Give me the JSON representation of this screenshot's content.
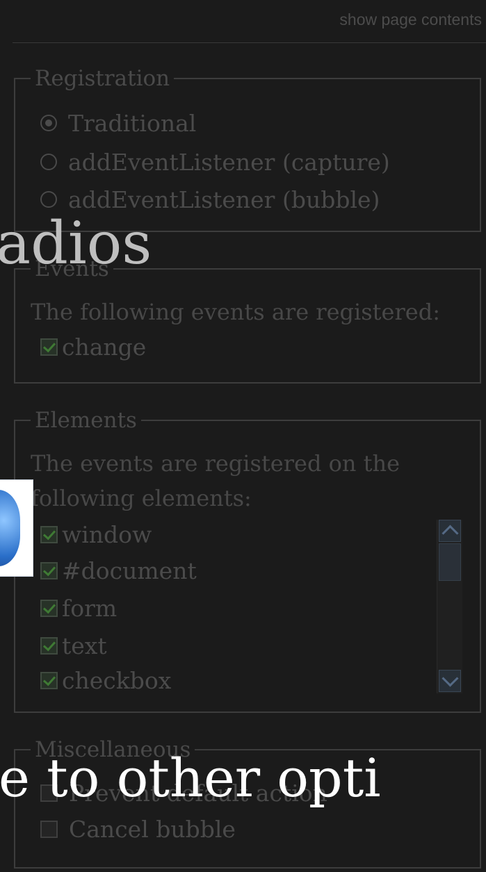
{
  "header": {
    "show_contents": "show page contents"
  },
  "registration": {
    "legend": "Registration",
    "options": [
      {
        "label": "Traditional",
        "selected": true
      },
      {
        "label": "addEventListener (capture)",
        "selected": false
      },
      {
        "label": "addEventListener (bubble)",
        "selected": false
      }
    ]
  },
  "events": {
    "legend": "Events",
    "intro": "The following events are registered:",
    "items": [
      {
        "label": "change",
        "checked": true
      }
    ]
  },
  "elements": {
    "legend": "Elements",
    "intro_line1": "The events are registered on the",
    "intro_line2": "following elements:",
    "items": [
      {
        "label": "window",
        "checked": true
      },
      {
        "label": "#document",
        "checked": true
      },
      {
        "label": "form",
        "checked": true
      },
      {
        "label": "text",
        "checked": true
      },
      {
        "label": "checkbox",
        "checked": true
      }
    ]
  },
  "misc": {
    "legend": "Miscellaneous",
    "items": [
      {
        "label": "Prevent default action",
        "checked": false
      },
      {
        "label": "Cancel bubble",
        "checked": false
      }
    ]
  },
  "overlay": {
    "title_fragment": "adios",
    "caption_fragment": "e to other opti"
  },
  "colors": {
    "background": "#1b1b1b",
    "overlay_text": "#ffffff",
    "check_green": "#3f7a34"
  }
}
